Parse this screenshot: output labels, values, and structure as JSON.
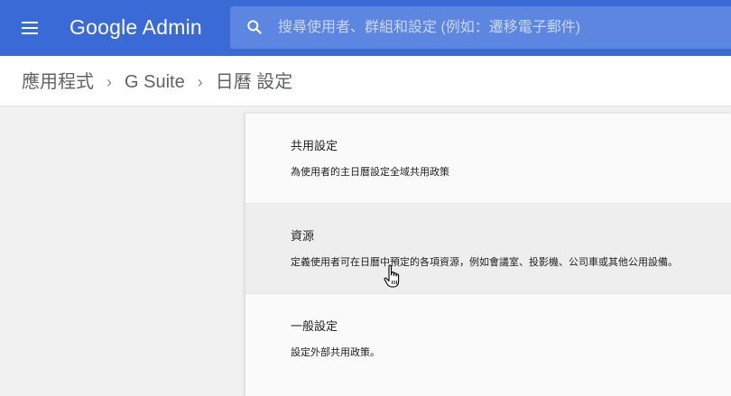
{
  "header": {
    "logo_text": "Google Admin",
    "search_placeholder": "搜尋使用者、群組和設定 (例如：遷移電子郵件)",
    "menu_icon": "hamburger-menu-icon",
    "search_icon": "search-icon",
    "color": "#3a6ad6"
  },
  "breadcrumb": {
    "items": [
      "應用程式",
      "G Suite",
      "日曆 設定"
    ],
    "separator": "›"
  },
  "settings": {
    "rows": [
      {
        "title": "共用設定",
        "description": "為使用者的主日曆設定全域共用政策"
      },
      {
        "title": "資源",
        "description": "定義使用者可在日曆中預定的各項資源，例如會議室、投影機、公司車或其他公用設備。"
      },
      {
        "title": "一般設定",
        "description": "設定外部共用政策。"
      }
    ]
  }
}
